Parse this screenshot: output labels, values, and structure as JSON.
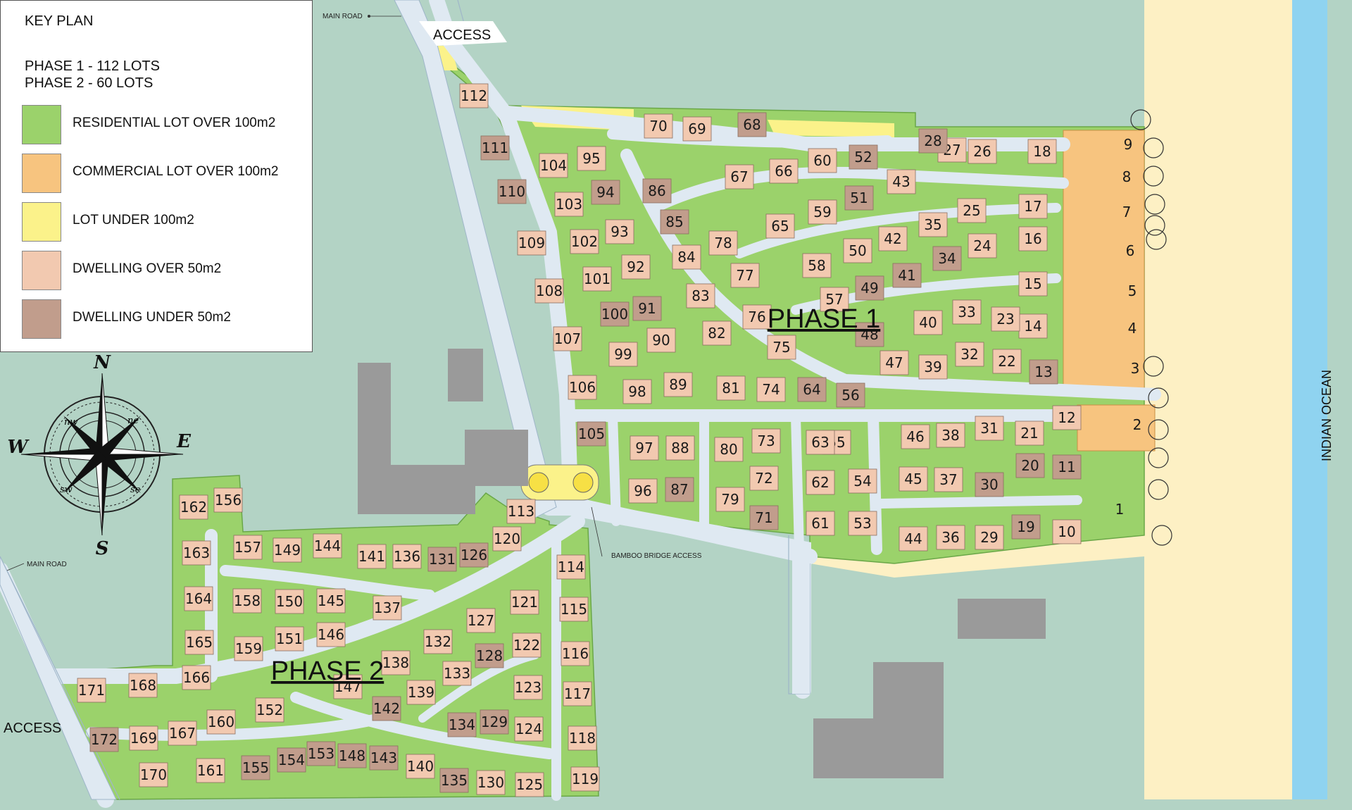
{
  "legend": {
    "title": "KEY PLAN",
    "phase1": "PHASE 1 - 112 LOTS",
    "phase2": "PHASE 2 - 60 LOTS",
    "items": [
      {
        "label": "RESIDENTIAL LOT OVER 100m2",
        "color": "#9bd26b"
      },
      {
        "label": "COMMERCIAL LOT OVER 100m2",
        "color": "#f7c47f"
      },
      {
        "label": "LOT UNDER 100m2",
        "color": "#fbf28a"
      },
      {
        "label": "DWELLING OVER 50m2",
        "color": "#f2c9b0"
      },
      {
        "label": "DWELLING UNDER 50m2",
        "color": "#c19d8c"
      }
    ]
  },
  "labels": {
    "main_road_top": "MAIN ROAD",
    "main_road_left": "MAIN ROAD",
    "access_top": "ACCESS",
    "access_left": "ACCESS",
    "bamboo_bridge": "BAMBOO BRIDGE ACCESS",
    "ocean": "INDIAN OCEAN",
    "phase1": "PHASE 1",
    "phase2": "PHASE 2"
  },
  "compass": {
    "n": "N",
    "s": "S",
    "e": "E",
    "w": "W",
    "ne": "ne",
    "nw": "nw",
    "se": "se",
    "sw": "sw"
  },
  "colors": {
    "land": "#b3d3c5",
    "road": "#dfe9f2",
    "road_edge": "#9fb6c9",
    "beach": "#fdf0c4",
    "ocean": "#8fd3f0",
    "building": "#9a9a9a",
    "residential": "#9bd26b",
    "commercial": "#f7c47f",
    "small_lot": "#fbf28a",
    "dwelling_large": "#f2c9b0",
    "dwelling_small": "#c19d8c"
  },
  "phase1_lots": [
    "1",
    "2",
    "3",
    "4",
    "5",
    "6",
    "7",
    "8",
    "9",
    "10",
    "11",
    "12",
    "13",
    "14",
    "15",
    "16",
    "17",
    "18",
    "19",
    "20",
    "21",
    "22",
    "23",
    "24",
    "25",
    "26",
    "27",
    "28",
    "29",
    "30",
    "31",
    "32",
    "33",
    "34",
    "35",
    "36",
    "37",
    "38",
    "39",
    "40",
    "41",
    "42",
    "43",
    "44",
    "45",
    "46",
    "47",
    "48",
    "49",
    "50",
    "51",
    "52",
    "53",
    "54",
    "55",
    "56",
    "57",
    "58",
    "59",
    "60",
    "61",
    "62",
    "63",
    "64",
    "65",
    "66",
    "67",
    "68",
    "69",
    "70",
    "71",
    "72",
    "73",
    "74",
    "75",
    "76",
    "77",
    "78",
    "79",
    "80",
    "81",
    "82",
    "83",
    "84",
    "85",
    "86",
    "87",
    "88",
    "89",
    "90",
    "91",
    "92",
    "93",
    "94",
    "95",
    "96",
    "97",
    "98",
    "99",
    "100",
    "101",
    "102",
    "103",
    "104",
    "105",
    "106",
    "107",
    "108",
    "109",
    "110",
    "111",
    "112"
  ],
  "phase2_lots": [
    "113",
    "114",
    "115",
    "116",
    "117",
    "118",
    "119",
    "120",
    "121",
    "122",
    "123",
    "124",
    "125",
    "126",
    "127",
    "128",
    "129",
    "130",
    "131",
    "132",
    "133",
    "134",
    "135",
    "136",
    "137",
    "138",
    "139",
    "140",
    "141",
    "142",
    "143",
    "144",
    "145",
    "146",
    "147",
    "148",
    "149",
    "150",
    "151",
    "152",
    "153",
    "154",
    "155",
    "156",
    "157",
    "158",
    "159",
    "160",
    "161",
    "162",
    "163",
    "164",
    "165",
    "166",
    "167",
    "168",
    "169",
    "170",
    "171",
    "172"
  ],
  "small_dwelling_lots": [
    "11",
    "13",
    "19",
    "20",
    "28",
    "30",
    "34",
    "41",
    "48",
    "49",
    "51",
    "52",
    "56",
    "64",
    "68",
    "71",
    "85",
    "86",
    "87",
    "91",
    "94",
    "100",
    "105",
    "110",
    "111",
    "126",
    "128",
    "129",
    "131",
    "134",
    "135",
    "142",
    "143",
    "148",
    "153",
    "154",
    "155",
    "172"
  ]
}
